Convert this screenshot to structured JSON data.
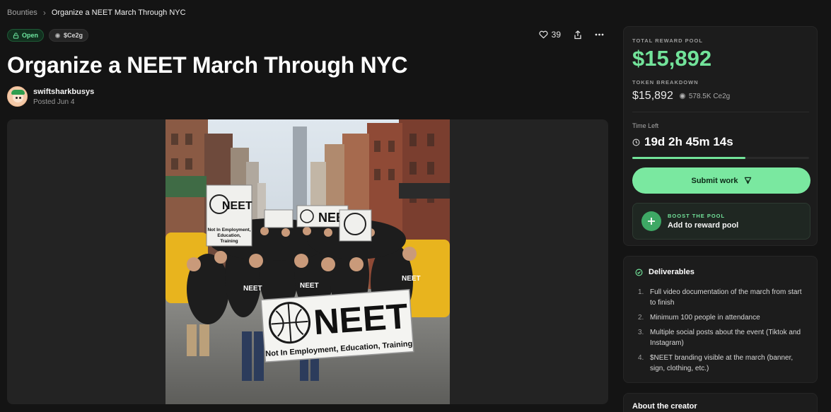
{
  "breadcrumb": {
    "root": "Bounties",
    "separator": "›",
    "current": "Organize a NEET March Through NYC"
  },
  "badges": {
    "status": "Open",
    "token": "$Ce2g"
  },
  "actions": {
    "likes": "39"
  },
  "page": {
    "title": "Organize a NEET March Through NYC"
  },
  "author": {
    "name": "swiftsharkbusys",
    "posted": "Posted Jun 4"
  },
  "media": {
    "sign_main_big": "NEET",
    "sign_main_sub": "Not In Employment, Education, Training",
    "sign_left_big": "NEET",
    "sign_left_sub": "Not In Employment, Education, Training",
    "sign_mid": "NEET",
    "shirt_text": "NEET"
  },
  "reward": {
    "pool_label": "TOTAL REWARD POOL",
    "pool_amount": "$15,892",
    "breakdown_label": "TOKEN BREAKDOWN",
    "breakdown_usd": "$15,892",
    "breakdown_token": "578.5K Ce2g",
    "time_label": "Time Left",
    "time_left": "19d 2h 45m 14s",
    "time_progress": 0.64,
    "submit_label": "Submit work",
    "boost_label": "BOOST THE POOL",
    "boost_action": "Add to reward pool"
  },
  "deliverables": {
    "title": "Deliverables",
    "items": [
      {
        "num": "1.",
        "text": "Full video documentation of the march from start to finish"
      },
      {
        "num": "2.",
        "text": "Minimum 100 people in attendance"
      },
      {
        "num": "3.",
        "text": "Multiple social posts about the event (Tiktok and Instagram)"
      },
      {
        "num": "4.",
        "text": "$NEET branding visible at the march (banner, sign, clothing, etc.)"
      }
    ]
  },
  "about": {
    "title": "About the creator"
  },
  "colors": {
    "accent": "#72e39a",
    "background": "#141414",
    "card": "#1c1c1c"
  }
}
